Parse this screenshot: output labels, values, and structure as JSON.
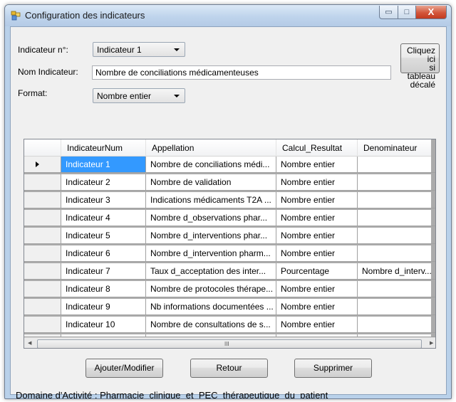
{
  "window": {
    "title": "Configuration des indicateurs",
    "minimize_glyph": "▭",
    "maximize_glyph": "□",
    "close_glyph": "X"
  },
  "form": {
    "indicateur_label": "Indicateur n°:",
    "indicateur_value": "Indicateur 1",
    "nom_label": "Nom Indicateur:",
    "nom_value": "Nombre de conciliations médicamenteuses",
    "format_label": "Format:",
    "format_value": "Nombre entier",
    "shift_button": [
      "Cliquez ici",
      "si tableau",
      "décalé"
    ]
  },
  "grid": {
    "columns": [
      "IndicateurNum",
      "Appellation",
      "Calcul_Resultat",
      "Denominateur"
    ],
    "selected_row": 0,
    "rows": [
      [
        "Indicateur 1",
        "Nombre de conciliations médi...",
        "Nombre entier",
        ""
      ],
      [
        "Indicateur 2",
        "Nombre de validation",
        "Nombre entier",
        ""
      ],
      [
        "Indicateur 3",
        "Indications médicaments T2A ...",
        "Nombre entier",
        ""
      ],
      [
        "Indicateur 4",
        "Nombre d_observations phar...",
        "Nombre entier",
        ""
      ],
      [
        "Indicateur 5",
        "Nombre d_interventions phar...",
        "Nombre entier",
        ""
      ],
      [
        "Indicateur 6",
        "Nombre d_intervention pharm...",
        "Nombre entier",
        ""
      ],
      [
        "Indicateur 7",
        "Taux d_acceptation des inter...",
        "Pourcentage",
        "Nombre d_interv..."
      ],
      [
        "Indicateur 8",
        "Nombre de protocoles thérape...",
        "Nombre entier",
        ""
      ],
      [
        "Indicateur 9",
        "Nb informations documentées ...",
        "Nombre entier",
        ""
      ],
      [
        "Indicateur 10",
        "Nombre de consultations de s...",
        "Nombre entier",
        ""
      ]
    ],
    "vscroll_grip": "≡",
    "hscroll_grip": "III"
  },
  "buttons": {
    "add_modify": "Ajouter/Modifier",
    "back": "Retour",
    "delete": "Supprimer"
  },
  "status": {
    "domain_text": "Domaine d'Activité :  Pharmacie_clinique_et_PEC_thérapeutique_du_patient"
  }
}
